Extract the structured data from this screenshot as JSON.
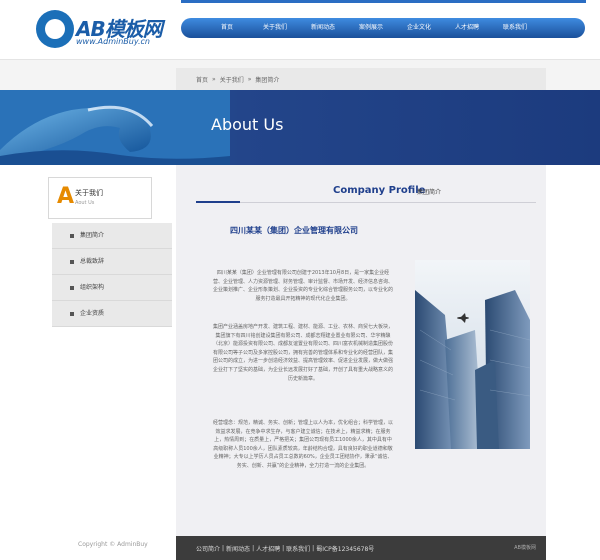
{
  "logo": {
    "title": "AB模板网",
    "url": "www.AdminBuy.cn"
  },
  "nav": [
    "首页",
    "关于我们",
    "新闻动态",
    "案例展示",
    "企业文化",
    "人才招聘",
    "联系我们"
  ],
  "breadcrumb": [
    "首页",
    "»",
    "关于我们",
    "»",
    "集团简介"
  ],
  "banner": {
    "title": "About Us"
  },
  "sidebar": {
    "head_mark": "A",
    "title": "关于我们",
    "subtitle": "Aout Us",
    "items": [
      "集团简介",
      "总裁致辞",
      "组织架构",
      "企业资质"
    ]
  },
  "main": {
    "heading": "Company Profile",
    "heading_sub": "集团简介",
    "company_name": "四川某某（集团）企业管理有限公司",
    "paragraphs": [
      "四川某某（集团）企业管理有限公司创建于2013年10月8日，是一家集企业经营、企业管理、人力资源管理、财务管理、审计监督、市场开发、经济信息咨询、企业策划推广、企业形象策划、企业投资的专业化综合管理服务公司，以专业化的服务打造最具开拓精神的现代化企业集团。",
      "集团产业涵盖房地产开发、建筑工程、建材、能源、工业、农林、商贸七大板块，集团旗下有四川铭创建设集团有限公司、成都志翔建业置业有限公司、华宇精酿（北京）能源投资有限公司、成都友谊置业有限公司、四川富农机械制造集团股份有限公司等子公司及多家控股公司，拥有完善的管理体系和专业化的经营团队，集团公司的成立，为进一步创造经济效益、提高管理效率、促进企业发展，做大做强企业打下了坚实的基础，为企业长远发展打好了基础，开创了具有重大战略意义的历史新篇章。",
      "经营理念：规范，精诚、务实、创新；管理上以人为本，优化组合；科学管理，以效益求发展，在竞争中求生存，与客户建立诚信；在技术上，精益求精；在服务上，热情周到；在质量上，严格把关；集团公司现有员工1000余人，其中具有中高级职称人员100余人，团队素质较高，年龄结构合理，具有良好的职业道德和敬业精神；大专以上学历人员占员工总数的60%，企业员工团结协作，秉承“诚信、务实、创新、共赢”的企业精神，全力打造一流的企业集团。"
    ]
  },
  "footer": {
    "links": [
      "公司简介",
      "|",
      "新闻动态",
      "|",
      "人才招聘",
      "|",
      "联系我们",
      "|",
      "蜀ICP备12345678号"
    ],
    "right": "AB模板网"
  },
  "copyright": "Copyright © AdminBuy"
}
